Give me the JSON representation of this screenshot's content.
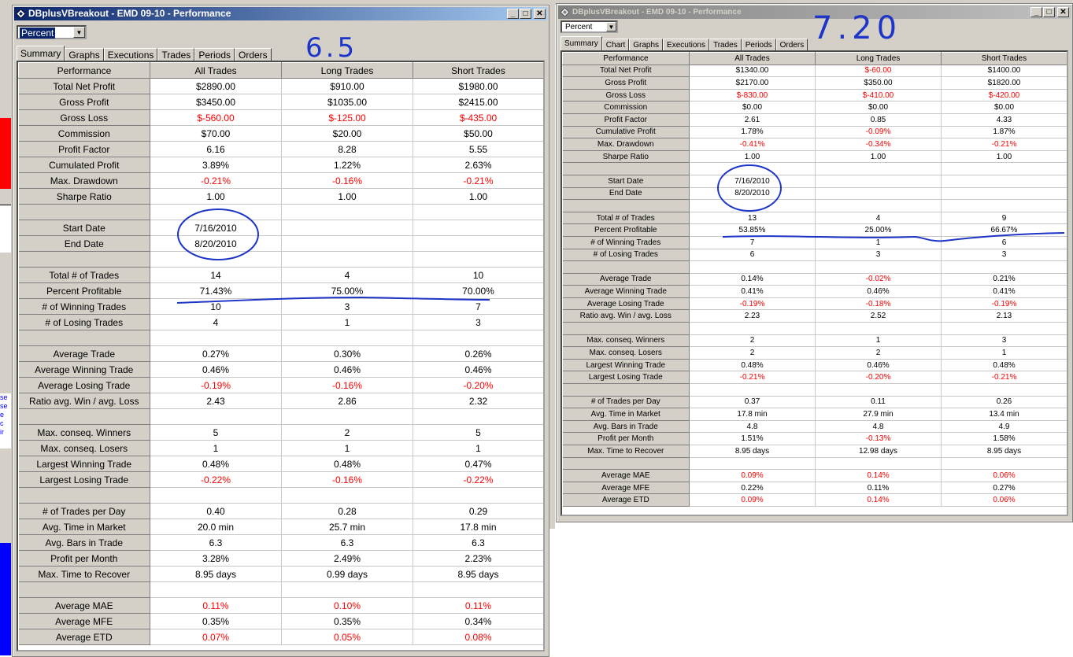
{
  "left_window": {
    "title": "DBplusVBreakout - EMD 09-10 - Performance",
    "view_select": "Percent",
    "tabs": [
      "Summary",
      "Graphs",
      "Executions",
      "Trades",
      "Periods",
      "Orders"
    ],
    "active_tab": "Summary",
    "handwritten_note": "6.5",
    "columns": [
      "Performance",
      "All Trades",
      "Long Trades",
      "Short Trades"
    ],
    "rows": [
      {
        "label": "Total Net Profit",
        "values": [
          "$2890.00",
          "$910.00",
          "$1980.00"
        ],
        "neg": [
          false,
          false,
          false
        ]
      },
      {
        "label": "Gross Profit",
        "values": [
          "$3450.00",
          "$1035.00",
          "$2415.00"
        ],
        "neg": [
          false,
          false,
          false
        ]
      },
      {
        "label": "Gross Loss",
        "values": [
          "$-560.00",
          "$-125.00",
          "$-435.00"
        ],
        "neg": [
          true,
          true,
          true
        ]
      },
      {
        "label": "Commission",
        "values": [
          "$70.00",
          "$20.00",
          "$50.00"
        ],
        "neg": [
          false,
          false,
          false
        ]
      },
      {
        "label": "Profit Factor",
        "values": [
          "6.16",
          "8.28",
          "5.55"
        ],
        "neg": [
          false,
          false,
          false
        ]
      },
      {
        "label": "Cumulated Profit",
        "values": [
          "3.89%",
          "1.22%",
          "2.63%"
        ],
        "neg": [
          false,
          false,
          false
        ]
      },
      {
        "label": "Max. Drawdown",
        "values": [
          "-0.21%",
          "-0.16%",
          "-0.21%"
        ],
        "neg": [
          true,
          true,
          true
        ]
      },
      {
        "label": "Sharpe Ratio",
        "values": [
          "1.00",
          "1.00",
          "1.00"
        ],
        "neg": [
          false,
          false,
          false
        ]
      },
      {
        "label": "",
        "values": [
          "",
          "",
          ""
        ],
        "neg": [
          false,
          false,
          false
        ]
      },
      {
        "label": "Start Date",
        "values": [
          "7/16/2010",
          "",
          ""
        ],
        "neg": [
          false,
          false,
          false
        ]
      },
      {
        "label": "End Date",
        "values": [
          "8/20/2010",
          "",
          ""
        ],
        "neg": [
          false,
          false,
          false
        ]
      },
      {
        "label": "",
        "values": [
          "",
          "",
          ""
        ],
        "neg": [
          false,
          false,
          false
        ]
      },
      {
        "label": "Total # of Trades",
        "values": [
          "14",
          "4",
          "10"
        ],
        "neg": [
          false,
          false,
          false
        ]
      },
      {
        "label": "Percent Profitable",
        "values": [
          "71.43%",
          "75.00%",
          "70.00%"
        ],
        "neg": [
          false,
          false,
          false
        ]
      },
      {
        "label": "# of Winning Trades",
        "values": [
          "10",
          "3",
          "7"
        ],
        "neg": [
          false,
          false,
          false
        ]
      },
      {
        "label": "# of Losing Trades",
        "values": [
          "4",
          "1",
          "3"
        ],
        "neg": [
          false,
          false,
          false
        ]
      },
      {
        "label": "",
        "values": [
          "",
          "",
          ""
        ],
        "neg": [
          false,
          false,
          false
        ]
      },
      {
        "label": "Average Trade",
        "values": [
          "0.27%",
          "0.30%",
          "0.26%"
        ],
        "neg": [
          false,
          false,
          false
        ]
      },
      {
        "label": "Average Winning Trade",
        "values": [
          "0.46%",
          "0.46%",
          "0.46%"
        ],
        "neg": [
          false,
          false,
          false
        ]
      },
      {
        "label": "Average Losing Trade",
        "values": [
          "-0.19%",
          "-0.16%",
          "-0.20%"
        ],
        "neg": [
          true,
          true,
          true
        ]
      },
      {
        "label": "Ratio avg. Win / avg. Loss",
        "values": [
          "2.43",
          "2.86",
          "2.32"
        ],
        "neg": [
          false,
          false,
          false
        ]
      },
      {
        "label": "",
        "values": [
          "",
          "",
          ""
        ],
        "neg": [
          false,
          false,
          false
        ]
      },
      {
        "label": "Max. conseq. Winners",
        "values": [
          "5",
          "2",
          "5"
        ],
        "neg": [
          false,
          false,
          false
        ]
      },
      {
        "label": "Max. conseq. Losers",
        "values": [
          "1",
          "1",
          "1"
        ],
        "neg": [
          false,
          false,
          false
        ]
      },
      {
        "label": "Largest Winning Trade",
        "values": [
          "0.48%",
          "0.48%",
          "0.47%"
        ],
        "neg": [
          false,
          false,
          false
        ]
      },
      {
        "label": "Largest Losing Trade",
        "values": [
          "-0.22%",
          "-0.16%",
          "-0.22%"
        ],
        "neg": [
          true,
          true,
          true
        ]
      },
      {
        "label": "",
        "values": [
          "",
          "",
          ""
        ],
        "neg": [
          false,
          false,
          false
        ]
      },
      {
        "label": "# of Trades per Day",
        "values": [
          "0.40",
          "0.28",
          "0.29"
        ],
        "neg": [
          false,
          false,
          false
        ]
      },
      {
        "label": "Avg. Time in Market",
        "values": [
          "20.0 min",
          "25.7 min",
          "17.8 min"
        ],
        "neg": [
          false,
          false,
          false
        ]
      },
      {
        "label": "Avg. Bars in Trade",
        "values": [
          "6.3",
          "6.3",
          "6.3"
        ],
        "neg": [
          false,
          false,
          false
        ]
      },
      {
        "label": "Profit per Month",
        "values": [
          "3.28%",
          "2.49%",
          "2.23%"
        ],
        "neg": [
          false,
          false,
          false
        ]
      },
      {
        "label": "Max. Time to Recover",
        "values": [
          "8.95 days",
          "0.99 days",
          "8.95 days"
        ],
        "neg": [
          false,
          false,
          false
        ]
      },
      {
        "label": "",
        "values": [
          "",
          "",
          ""
        ],
        "neg": [
          false,
          false,
          false
        ]
      },
      {
        "label": "Average MAE",
        "values": [
          "0.11%",
          "0.10%",
          "0.11%"
        ],
        "neg": [
          true,
          true,
          true
        ]
      },
      {
        "label": "Average MFE",
        "values": [
          "0.35%",
          "0.35%",
          "0.34%"
        ],
        "neg": [
          false,
          false,
          false
        ]
      },
      {
        "label": "Average ETD",
        "values": [
          "0.07%",
          "0.05%",
          "0.08%"
        ],
        "neg": [
          true,
          true,
          true
        ]
      }
    ]
  },
  "right_window": {
    "title": "DBplusVBreakout - EMD 09-10 - Performance",
    "view_select": "Percent",
    "tabs": [
      "Summary",
      "Chart",
      "Graphs",
      "Executions",
      "Trades",
      "Periods",
      "Orders"
    ],
    "active_tab": "Summary",
    "handwritten_note": "7.20",
    "columns": [
      "Performance",
      "All Trades",
      "Long Trades",
      "Short Trades"
    ],
    "rows": [
      {
        "label": "Total Net Profit",
        "values": [
          "$1340.00",
          "$-60.00",
          "$1400.00"
        ],
        "neg": [
          false,
          true,
          false
        ]
      },
      {
        "label": "Gross Profit",
        "values": [
          "$2170.00",
          "$350.00",
          "$1820.00"
        ],
        "neg": [
          false,
          false,
          false
        ]
      },
      {
        "label": "Gross Loss",
        "values": [
          "$-830.00",
          "$-410.00",
          "$-420.00"
        ],
        "neg": [
          true,
          true,
          true
        ]
      },
      {
        "label": "Commission",
        "values": [
          "$0.00",
          "$0.00",
          "$0.00"
        ],
        "neg": [
          false,
          false,
          false
        ]
      },
      {
        "label": "Profit Factor",
        "values": [
          "2.61",
          "0.85",
          "4.33"
        ],
        "neg": [
          false,
          false,
          false
        ]
      },
      {
        "label": "Cumulative Profit",
        "values": [
          "1.78%",
          "-0.09%",
          "1.87%"
        ],
        "neg": [
          false,
          true,
          false
        ]
      },
      {
        "label": "Max. Drawdown",
        "values": [
          "-0.41%",
          "-0.34%",
          "-0.21%"
        ],
        "neg": [
          true,
          true,
          true
        ]
      },
      {
        "label": "Sharpe Ratio",
        "values": [
          "1.00",
          "1.00",
          "1.00"
        ],
        "neg": [
          false,
          false,
          false
        ]
      },
      {
        "label": "",
        "values": [
          "",
          "",
          ""
        ],
        "neg": [
          false,
          false,
          false
        ]
      },
      {
        "label": "Start Date",
        "values": [
          "7/16/2010",
          "",
          ""
        ],
        "neg": [
          false,
          false,
          false
        ]
      },
      {
        "label": "End Date",
        "values": [
          "8/20/2010",
          "",
          ""
        ],
        "neg": [
          false,
          false,
          false
        ]
      },
      {
        "label": "",
        "values": [
          "",
          "",
          ""
        ],
        "neg": [
          false,
          false,
          false
        ]
      },
      {
        "label": "Total # of Trades",
        "values": [
          "13",
          "4",
          "9"
        ],
        "neg": [
          false,
          false,
          false
        ]
      },
      {
        "label": "Percent Profitable",
        "values": [
          "53.85%",
          "25.00%",
          "66.67%"
        ],
        "neg": [
          false,
          false,
          false
        ]
      },
      {
        "label": "# of Winning Trades",
        "values": [
          "7",
          "1",
          "6"
        ],
        "neg": [
          false,
          false,
          false
        ]
      },
      {
        "label": "# of Losing Trades",
        "values": [
          "6",
          "3",
          "3"
        ],
        "neg": [
          false,
          false,
          false
        ]
      },
      {
        "label": "",
        "values": [
          "",
          "",
          ""
        ],
        "neg": [
          false,
          false,
          false
        ]
      },
      {
        "label": "Average Trade",
        "values": [
          "0.14%",
          "-0.02%",
          "0.21%"
        ],
        "neg": [
          false,
          true,
          false
        ]
      },
      {
        "label": "Average Winning Trade",
        "values": [
          "0.41%",
          "0.46%",
          "0.41%"
        ],
        "neg": [
          false,
          false,
          false
        ]
      },
      {
        "label": "Average Losing Trade",
        "values": [
          "-0.19%",
          "-0.18%",
          "-0.19%"
        ],
        "neg": [
          true,
          true,
          true
        ]
      },
      {
        "label": "Ratio avg. Win / avg. Loss",
        "values": [
          "2.23",
          "2.52",
          "2.13"
        ],
        "neg": [
          false,
          false,
          false
        ]
      },
      {
        "label": "",
        "values": [
          "",
          "",
          ""
        ],
        "neg": [
          false,
          false,
          false
        ]
      },
      {
        "label": "Max. conseq. Winners",
        "values": [
          "2",
          "1",
          "3"
        ],
        "neg": [
          false,
          false,
          false
        ]
      },
      {
        "label": "Max. conseq. Losers",
        "values": [
          "2",
          "2",
          "1"
        ],
        "neg": [
          false,
          false,
          false
        ]
      },
      {
        "label": "Largest Winning Trade",
        "values": [
          "0.48%",
          "0.46%",
          "0.48%"
        ],
        "neg": [
          false,
          false,
          false
        ]
      },
      {
        "label": "Largest Losing Trade",
        "values": [
          "-0.21%",
          "-0.20%",
          "-0.21%"
        ],
        "neg": [
          true,
          true,
          true
        ]
      },
      {
        "label": "",
        "values": [
          "",
          "",
          ""
        ],
        "neg": [
          false,
          false,
          false
        ]
      },
      {
        "label": "# of Trades per Day",
        "values": [
          "0.37",
          "0.11",
          "0.26"
        ],
        "neg": [
          false,
          false,
          false
        ]
      },
      {
        "label": "Avg. Time in Market",
        "values": [
          "17.8 min",
          "27.9 min",
          "13.4 min"
        ],
        "neg": [
          false,
          false,
          false
        ]
      },
      {
        "label": "Avg. Bars in Trade",
        "values": [
          "4.8",
          "4.8",
          "4.9"
        ],
        "neg": [
          false,
          false,
          false
        ]
      },
      {
        "label": "Profit per Month",
        "values": [
          "1.51%",
          "-0.13%",
          "1.58%"
        ],
        "neg": [
          false,
          true,
          false
        ]
      },
      {
        "label": "Max. Time to Recover",
        "values": [
          "8.95 days",
          "12.98 days",
          "8.95 days"
        ],
        "neg": [
          false,
          false,
          false
        ]
      },
      {
        "label": "",
        "values": [
          "",
          "",
          ""
        ],
        "neg": [
          false,
          false,
          false
        ]
      },
      {
        "label": "Average MAE",
        "values": [
          "0.09%",
          "0.14%",
          "0.06%"
        ],
        "neg": [
          true,
          true,
          true
        ]
      },
      {
        "label": "Average MFE",
        "values": [
          "0.22%",
          "0.11%",
          "0.27%"
        ],
        "neg": [
          false,
          false,
          false
        ]
      },
      {
        "label": "Average ETD",
        "values": [
          "0.09%",
          "0.14%",
          "0.06%"
        ],
        "neg": [
          true,
          true,
          true
        ]
      }
    ]
  },
  "background_fragments": [
    "se",
    "se",
    "e",
    "c",
    "ir"
  ],
  "colors": {
    "negative": "#ff0000",
    "ink": "#1d35c8",
    "active_title": "#0a246a",
    "inactive_title": "#808080",
    "chart_fill_blue": "#0000ff",
    "chart_fill_red": "#ff0000"
  }
}
